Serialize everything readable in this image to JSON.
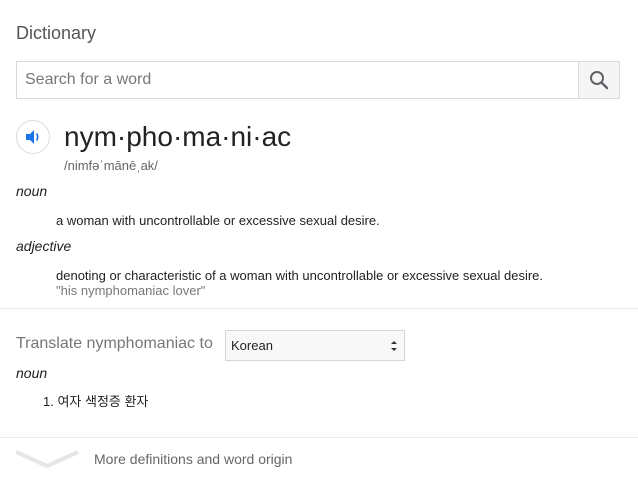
{
  "card": {
    "title": "Dictionary",
    "search": {
      "placeholder": "Search for a word",
      "value": "",
      "button_icon": "search-icon"
    },
    "entry": {
      "headword": "nym·pho·ma·ni·ac",
      "phonetic": "/nimfəˈmānēˌak/",
      "audio_icon": "speaker-icon",
      "senses": [
        {
          "pos": "noun",
          "definition": "a woman with uncontrollable or excessive sexual desire.",
          "example": ""
        },
        {
          "pos": "adjective",
          "definition": "denoting or characteristic of a woman with uncontrollable or excessive sexual desire.",
          "example": "\"his nymphomaniac lover\""
        }
      ]
    },
    "translate": {
      "label": "Translate nymphomaniac to",
      "language": "Korean",
      "pos": "noun",
      "items": [
        "1. 여자 색정증 환자"
      ]
    },
    "footer": {
      "more_label": "More definitions and word origin",
      "chevron_icon": "chevron-down-icon"
    }
  },
  "colors": {
    "accent_blue": "#1a73e8",
    "text": "#222222",
    "muted": "#777777",
    "border": "#d9d9d9"
  }
}
